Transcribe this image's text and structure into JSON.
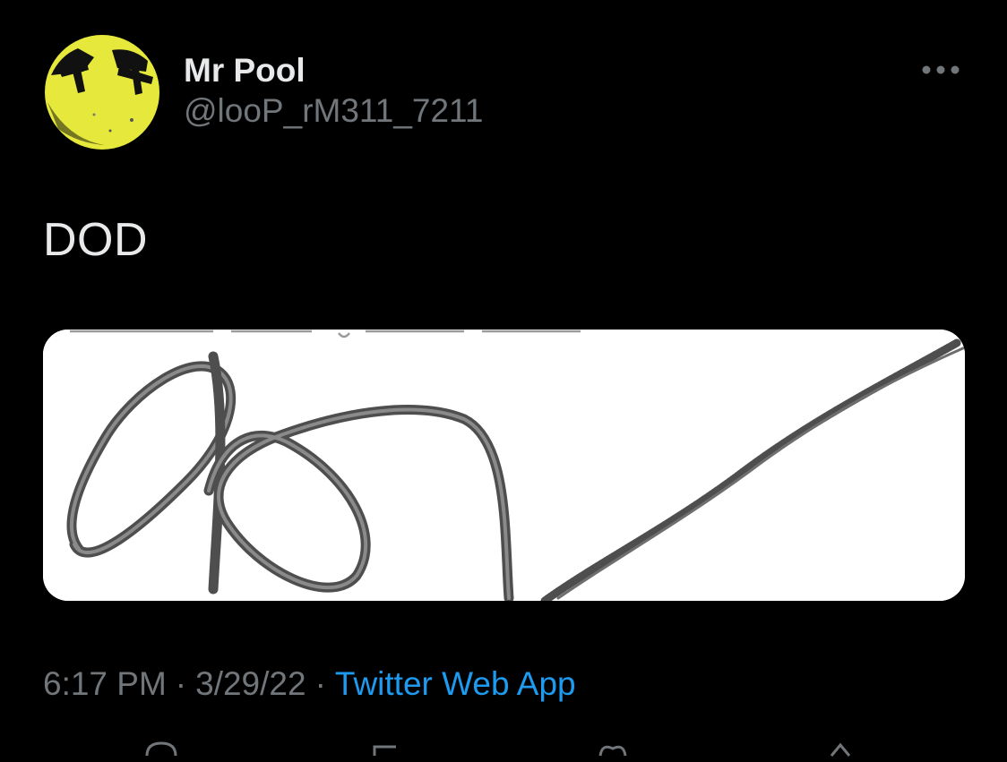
{
  "tweet": {
    "author": {
      "display_name": "Mr Pool",
      "handle": "@looP_rM311_7211",
      "avatar_icon": "yellow-face-avatar",
      "avatar_color": "#e8ea3a"
    },
    "more_icon": "more-horizontal-icon",
    "text": "DOD",
    "media": {
      "kind": "image",
      "content": "signature scan",
      "background": "#ffffff",
      "ink_color": "#5a5a5a"
    },
    "meta": {
      "time": "6:17 PM",
      "separator": "·",
      "date": "3/29/22",
      "source": "Twitter Web App",
      "source_color": "#1d9bf0"
    },
    "actions": [
      {
        "icon": "reply-icon"
      },
      {
        "icon": "retweet-icon"
      },
      {
        "icon": "like-icon"
      },
      {
        "icon": "share-icon"
      }
    ]
  }
}
